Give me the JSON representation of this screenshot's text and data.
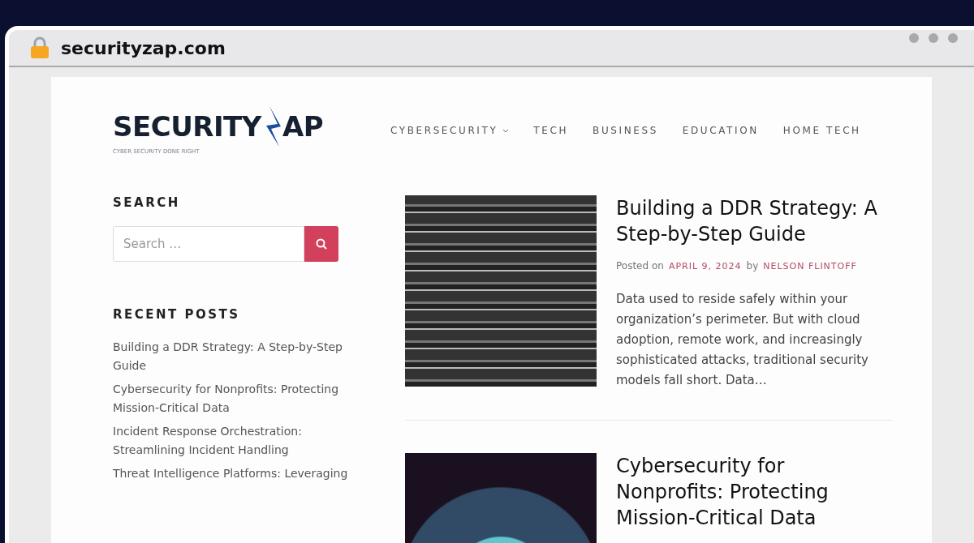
{
  "browser": {
    "url": "securityzap.com"
  },
  "site": {
    "logo": {
      "text_before": "SECURITY",
      "text_after": "AP",
      "tagline": "CYBER SECURITY DONE RIGHT"
    },
    "nav": [
      {
        "label": "CYBERSECURITY",
        "dropdown": true
      },
      {
        "label": "TECH",
        "dropdown": false
      },
      {
        "label": "BUSINESS",
        "dropdown": false
      },
      {
        "label": "EDUCATION",
        "dropdown": false
      },
      {
        "label": "HOME TECH",
        "dropdown": false
      }
    ]
  },
  "sidebar": {
    "search": {
      "title": "SEARCH",
      "placeholder": "Search …"
    },
    "recent_posts": {
      "title": "RECENT POSTS",
      "items": [
        "Building a DDR Strategy: A Step-by-Step Guide",
        "Cybersecurity for Nonprofits: Protecting Mission-Critical Data",
        "Incident Response Orchestration: Streamlining Incident Handling",
        "Threat Intelligence Platforms: Leveraging"
      ]
    }
  },
  "posts": [
    {
      "title": "Building a DDR Strategy: A Step-by-Step Guide",
      "posted_on": "Posted on",
      "date": "APRIL 9, 2024",
      "by": "by",
      "author": "NELSON FLINTOFF",
      "excerpt": "Data used to reside safely within your organization’s perimeter. But with cloud adoption, remote work, and increasingly sophisticated attacks, traditional security models fall short. Data…"
    },
    {
      "title": "Cybersecurity for Nonprofits: Protecting Mission-Critical Data"
    }
  ]
}
